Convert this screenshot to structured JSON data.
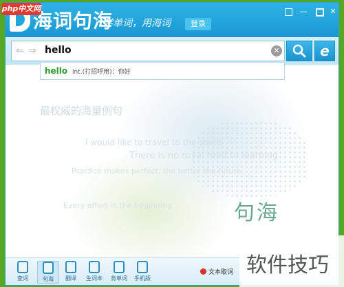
{
  "window": {
    "logo_text": "海词句海",
    "slogan": "学单词，用海词",
    "login_label": "登录",
    "controls": {
      "skin": "",
      "minimize": "—",
      "maximize": "",
      "close": "✕"
    }
  },
  "search": {
    "back_arrow": "⇐",
    "forward_arrow": "⇒",
    "query": "hello",
    "clear_glyph": "✕",
    "search_icon": "search-icon",
    "ie_label": "e"
  },
  "suggestion": {
    "word": "hello",
    "definition": "int.(打招呼用)：你好"
  },
  "content": {
    "slogan": "最权威的海量例句",
    "faded_lines": [
      "I would like to travel to the world",
      "There is no royal road to learning",
      "Practice makes perfect, the better the future",
      "Every effort in the beginning"
    ],
    "brand": "句海"
  },
  "bottom_bar": {
    "items": [
      {
        "label": "查词",
        "icon": "magnifier-icon"
      },
      {
        "label": "句海",
        "icon": "book-icon"
      },
      {
        "label": "翻译",
        "icon": "translate-icon"
      },
      {
        "label": "生词本",
        "icon": "notebook-icon"
      },
      {
        "label": "背单词",
        "icon": "flashcard-icon"
      },
      {
        "label": "手机版",
        "icon": "phone-icon"
      }
    ],
    "cancel_label": "文本取词"
  },
  "watermarks": {
    "php": "php中文网",
    "text": "软件技巧"
  },
  "colors": {
    "title_blue": "#1fa6dc",
    "desktop_green": "#55a824",
    "suggest_green": "#2f9b2f",
    "cancel_red": "#d9322a"
  }
}
